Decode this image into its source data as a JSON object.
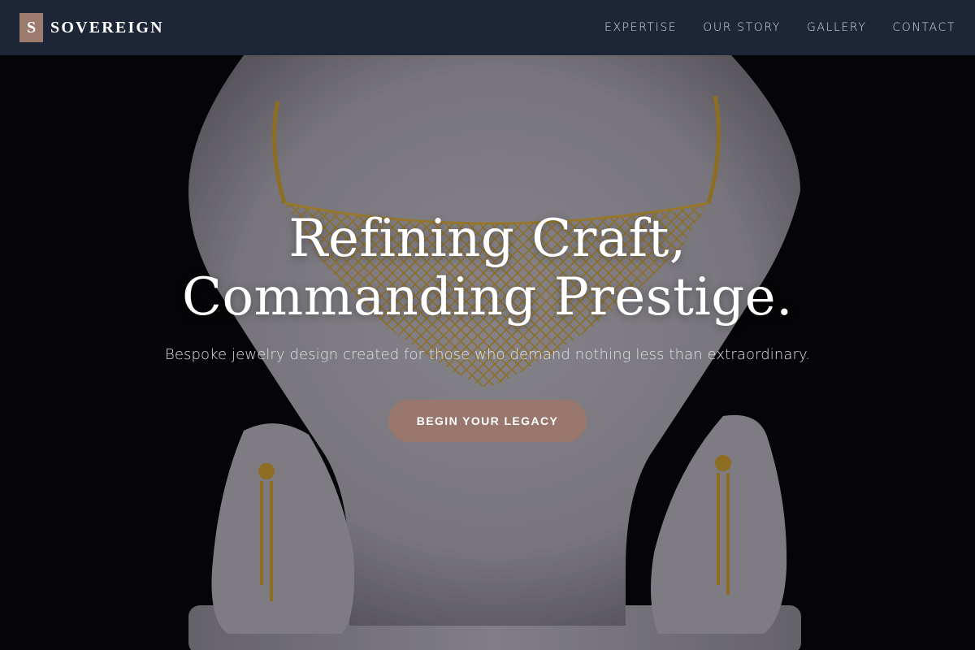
{
  "brand": {
    "mark": "S",
    "name": "SOVEREIGN"
  },
  "nav": {
    "items": [
      "EXPERTISE",
      "OUR STORY",
      "GALLERY",
      "CONTACT"
    ]
  },
  "hero": {
    "title_line1": "Refining Craft,",
    "title_line2": "Commanding Prestige.",
    "subtitle": "Bespoke jewelry design created for those who demand nothing less than extraordinary.",
    "cta_label": "BEGIN YOUR LEGACY"
  },
  "colors": {
    "header_bg": "#1e283a",
    "accent": "#9a776c",
    "gold": "#c89a2a",
    "bust": "#cfcdd2"
  }
}
